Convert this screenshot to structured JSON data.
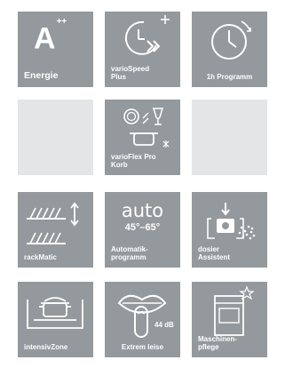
{
  "tiles": {
    "energie": {
      "label": "Energie",
      "rating": "A",
      "rating_plus": "++",
      "icon": "energy-rating-icon"
    },
    "vario_speed": {
      "label": "varioSpeed\nPlus",
      "icon": "clock-speed-icon"
    },
    "one_hour": {
      "label": "1h Programm",
      "icon": "one-hour-clock-icon"
    },
    "vario_flex": {
      "label": "varioFlex Pro\nKorb",
      "icon": "flexible-basket-icon"
    },
    "rack_matic": {
      "label": "rackMatic",
      "icon": "rack-height-icon"
    },
    "automatik": {
      "label": "Automatik-\nprogramm",
      "auto": "auto",
      "temp": "45°–65°",
      "icon": "auto-program-icon"
    },
    "dosier": {
      "label": "dosier\nAssistent",
      "icon": "dosage-assistant-icon"
    },
    "intensiv_zone": {
      "label": "intensivZone",
      "icon": "pot-icon"
    },
    "extrem_leise": {
      "label": "Extrem leise",
      "db": "44 dB",
      "icon": "quiet-lips-icon"
    },
    "maschinen_pflege": {
      "label": "Maschinen-\npflege",
      "icon": "machine-care-icon"
    }
  },
  "colors": {
    "tile": "#93999c",
    "empty_tile": "#e3e5e6",
    "text": "#ffffff"
  }
}
